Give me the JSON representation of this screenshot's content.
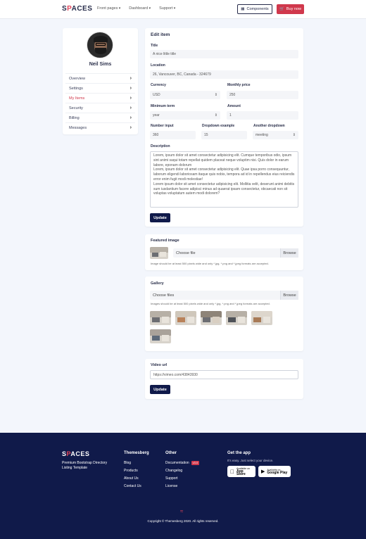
{
  "brand": {
    "logo_pre": "S",
    "logo_mark": "P",
    "logo_post": "ACES",
    "accent": "#e0445a",
    "primary": "#101a4a"
  },
  "nav": {
    "links": [
      "Front pages",
      "Dashboard",
      "Support"
    ],
    "components_label": "Components",
    "buy_label": "Buy now"
  },
  "sidebar": {
    "user_name": "Neil Sims",
    "items": [
      {
        "label": "Overview"
      },
      {
        "label": "Settings"
      },
      {
        "label": "My Items"
      },
      {
        "label": "Security"
      },
      {
        "label": "Billing"
      },
      {
        "label": "Messages"
      }
    ]
  },
  "edit": {
    "heading": "Edit item",
    "title_label": "Title",
    "title_value": "A nice little title",
    "location_label": "Location",
    "location_value": "26, Vancouver, BC, Canada - 324679",
    "currency_label": "Currency",
    "currency_value": "USD",
    "monthly_label": "Monthly price",
    "monthly_value": "250",
    "term_label": "Minimum term",
    "term_value": "year",
    "amount_label": "Amount",
    "amount_value": "1",
    "number_label": "Number input",
    "number_value": "360",
    "dropdown_label": "Dropdown example",
    "dropdown_value": "15",
    "another_label": "Another dropdown",
    "another_value": "meeting",
    "description_label": "Description",
    "description_value": "Lorem, ipsum dolor sit amet consectetur adipisicing elit. Cumque temporibus odio, ipsum sint animi saqui totam repellat quidem placeat neque voluptim nisi. Quis dolor in earum labore, eponam dolorum\nLorem, ipsum dolor sit amet consectetur adipisicing elit. Quae ipsa porro consequuntur, laborum eligendi laboriosam itaque quis nobis, tempora ad id in repellendus eius reiciendis error enim fugit modi molestiae!\nLorem ipsum dolor sit amet consectetur adipisicing elit. Mollitia velit, deserunt animi debitis sum iusdantium facere adipisci minus ad quaerat ipsam consectetur, obcaecati non sit voluptas voluptatum autem modi dolorem?",
    "update_label": "Update"
  },
  "featured": {
    "heading": "Featured image",
    "placeholder": "Choose file",
    "browse": "Browse",
    "hint": "Image should be at least 500 pixels wide and only *.jpg, *.png and *.jpeg formats are accepted."
  },
  "gallery": {
    "heading": "Gallery",
    "placeholder": "Choose files",
    "browse": "Browse",
    "hint": "Images should be at least 500 pixels wide and only *.jpg, *.png and *.jpeg formats are accepted."
  },
  "video": {
    "heading": "Video url",
    "value": "https://vimeo.com/43843930",
    "update_label": "Update"
  },
  "footer": {
    "tagline": "Premium Bootstrap Directory Listing Template",
    "col1_title": "Themesberg",
    "col1_links": [
      "Blog",
      "Products",
      "About Us",
      "Contact Us"
    ],
    "col2_title": "Other",
    "col2_links": [
      "Documentation",
      "Changelog",
      "Support",
      "License"
    ],
    "col2_badge": "v3.0",
    "app_title": "Get the app",
    "app_sub": "It's easy. Just select your device.",
    "appstore_small": "Available on",
    "appstore_big": "App Store",
    "googleplay_small": "Available on",
    "googleplay_big": "Google Play",
    "copyright": "Copyright © Themesberg 2020. All rights reserved."
  }
}
